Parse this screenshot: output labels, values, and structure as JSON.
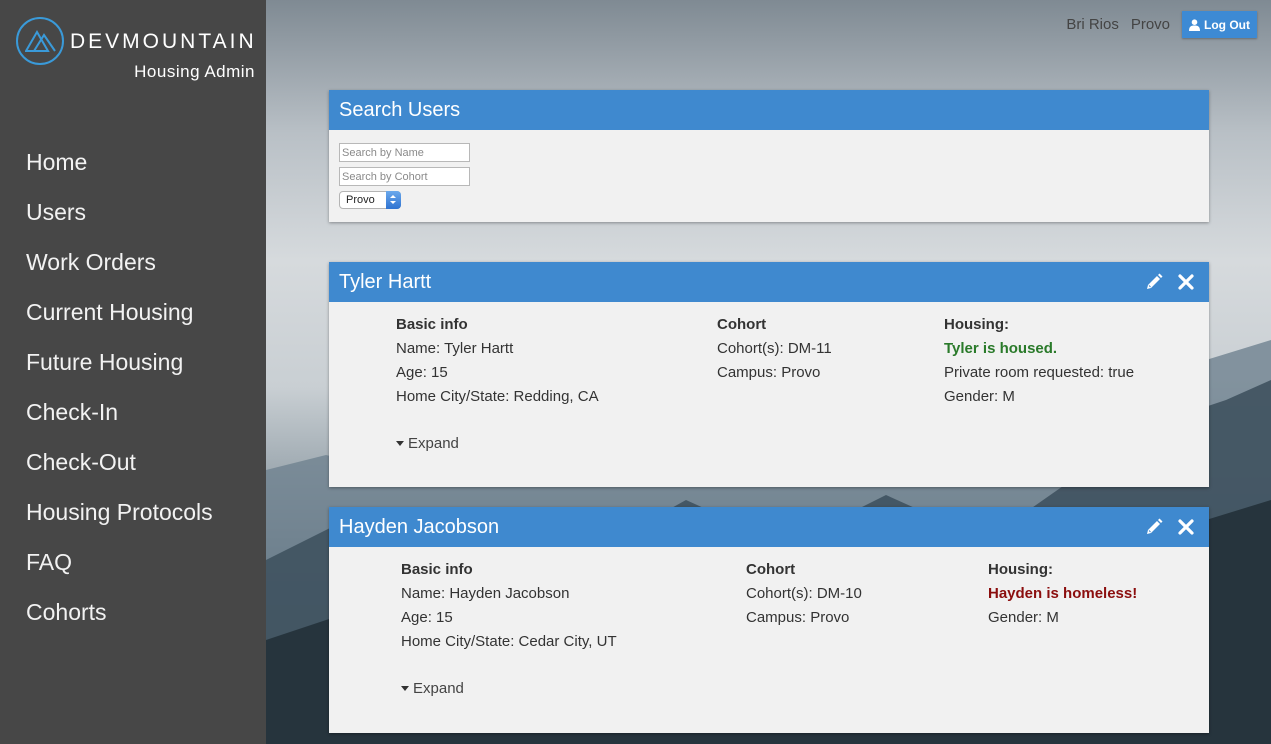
{
  "brand": {
    "name": "DEVMOUNTAIN",
    "subtitle": "Housing Admin",
    "accent_color": "#3a9ad9"
  },
  "nav": {
    "items": [
      {
        "label": "Home"
      },
      {
        "label": "Users"
      },
      {
        "label": "Work Orders"
      },
      {
        "label": "Current Housing"
      },
      {
        "label": "Future Housing"
      },
      {
        "label": "Check-In"
      },
      {
        "label": "Check-Out"
      },
      {
        "label": "Housing Protocols"
      },
      {
        "label": "FAQ"
      },
      {
        "label": "Cohorts"
      }
    ]
  },
  "topbar": {
    "user_name": "Bri Rios",
    "campus": "Provo",
    "logout_label": "Log Out"
  },
  "search": {
    "title": "Search Users",
    "name_placeholder": "Search by Name",
    "cohort_placeholder": "Search by Cohort",
    "campus_selected": "Provo"
  },
  "users": [
    {
      "header": "Tyler Hartt",
      "basic_heading": "Basic info",
      "name_line": "Name: Tyler Hartt",
      "age_line": "Age: 15",
      "city_line": "Home City/State: Redding, CA",
      "cohort_heading": "Cohort",
      "cohorts_line": "Cohort(s): DM-11",
      "campus_line": "Campus: Provo",
      "housing_heading": "Housing:",
      "housing_status": "Tyler is housed.",
      "private_room_line": "Private room requested: true",
      "gender_line": "Gender: M",
      "expand_label": "Expand"
    },
    {
      "header": "Hayden Jacobson",
      "basic_heading": "Basic info",
      "name_line": "Name: Hayden Jacobson",
      "age_line": "Age: 15",
      "city_line": "Home City/State: Cedar City, UT",
      "cohort_heading": "Cohort",
      "cohorts_line": "Cohort(s): DM-10",
      "campus_line": "Campus: Provo",
      "housing_heading": "Housing:",
      "housing_status": "Hayden is homeless!",
      "gender_line": "Gender: M",
      "expand_label": "Expand"
    }
  ],
  "colors": {
    "panel_header": "#3f89cf",
    "housed": "#2a7a2a",
    "homeless": "#8b0e0e",
    "sidebar": "#474747"
  }
}
